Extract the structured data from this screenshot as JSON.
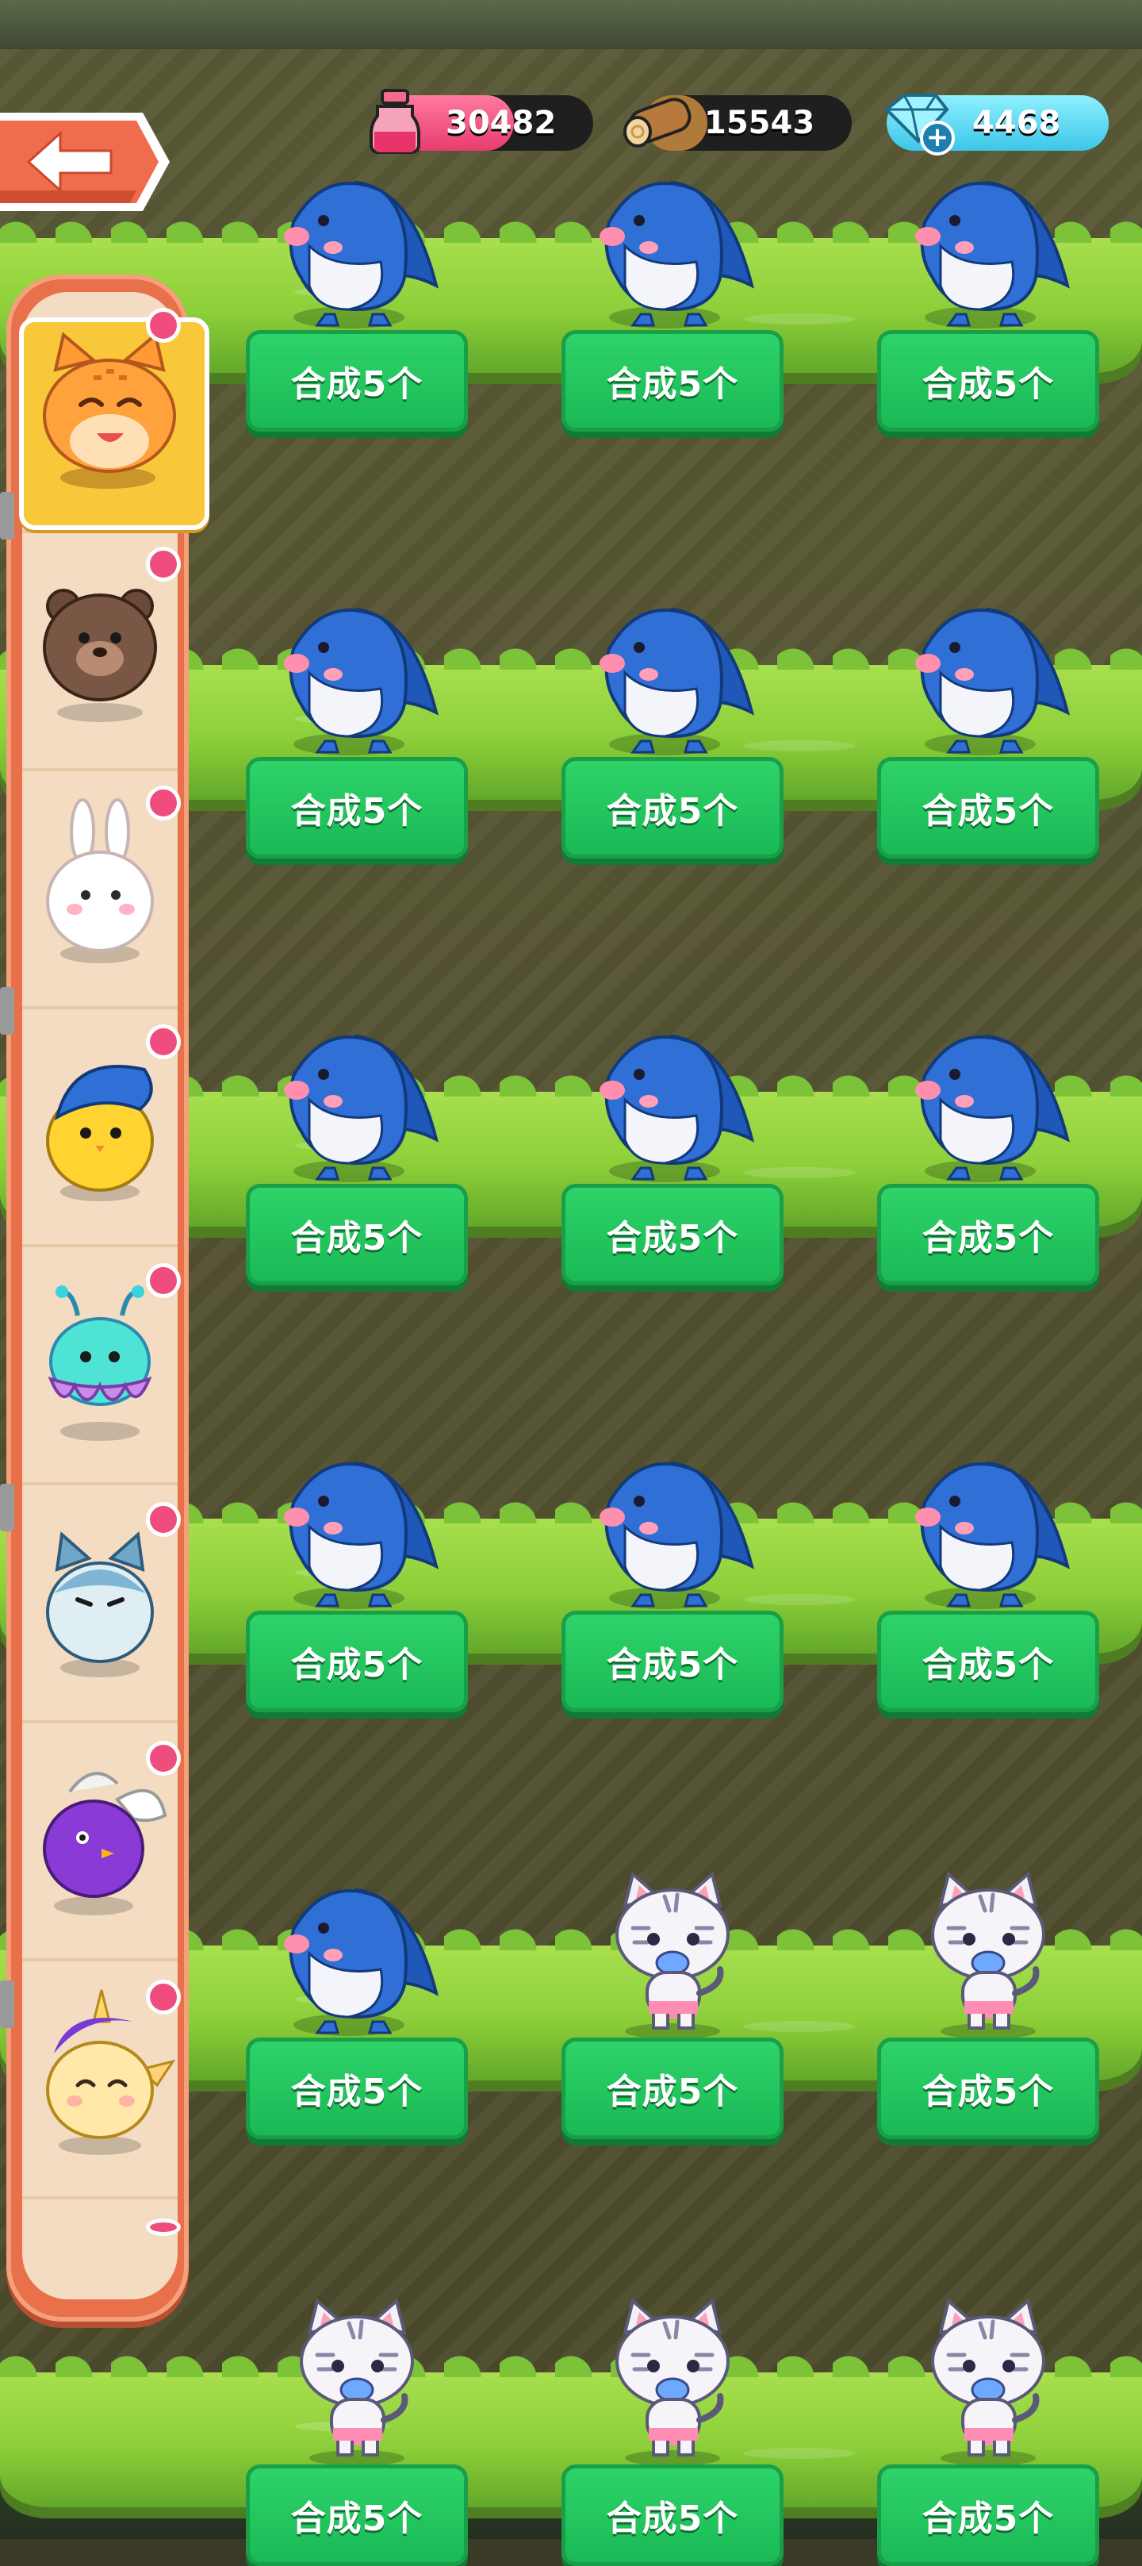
{
  "resources": {
    "potion": "30482",
    "wood": "15543",
    "gems": "4468"
  },
  "merge_label": "合成5个",
  "sidebar": {
    "items": [
      "cat",
      "bear",
      "rabbit",
      "blue-chick",
      "jellyfish",
      "blue-cat",
      "purple-bird",
      "unicorn"
    ]
  },
  "grid": {
    "rows": [
      [
        "shark",
        "shark",
        "shark"
      ],
      [
        "shark",
        "shark",
        "shark"
      ],
      [
        "shark",
        "shark",
        "shark"
      ],
      [
        "shark",
        "shark",
        "shark"
      ],
      [
        "shark",
        "tiger",
        "tiger"
      ],
      [
        "tiger",
        "tiger",
        "tiger"
      ]
    ]
  },
  "colors": {
    "button_green": "#19b855",
    "sidebar_orange": "#e8704a",
    "badge_pink": "#ef4d7e",
    "grass": "#8ccf39"
  }
}
